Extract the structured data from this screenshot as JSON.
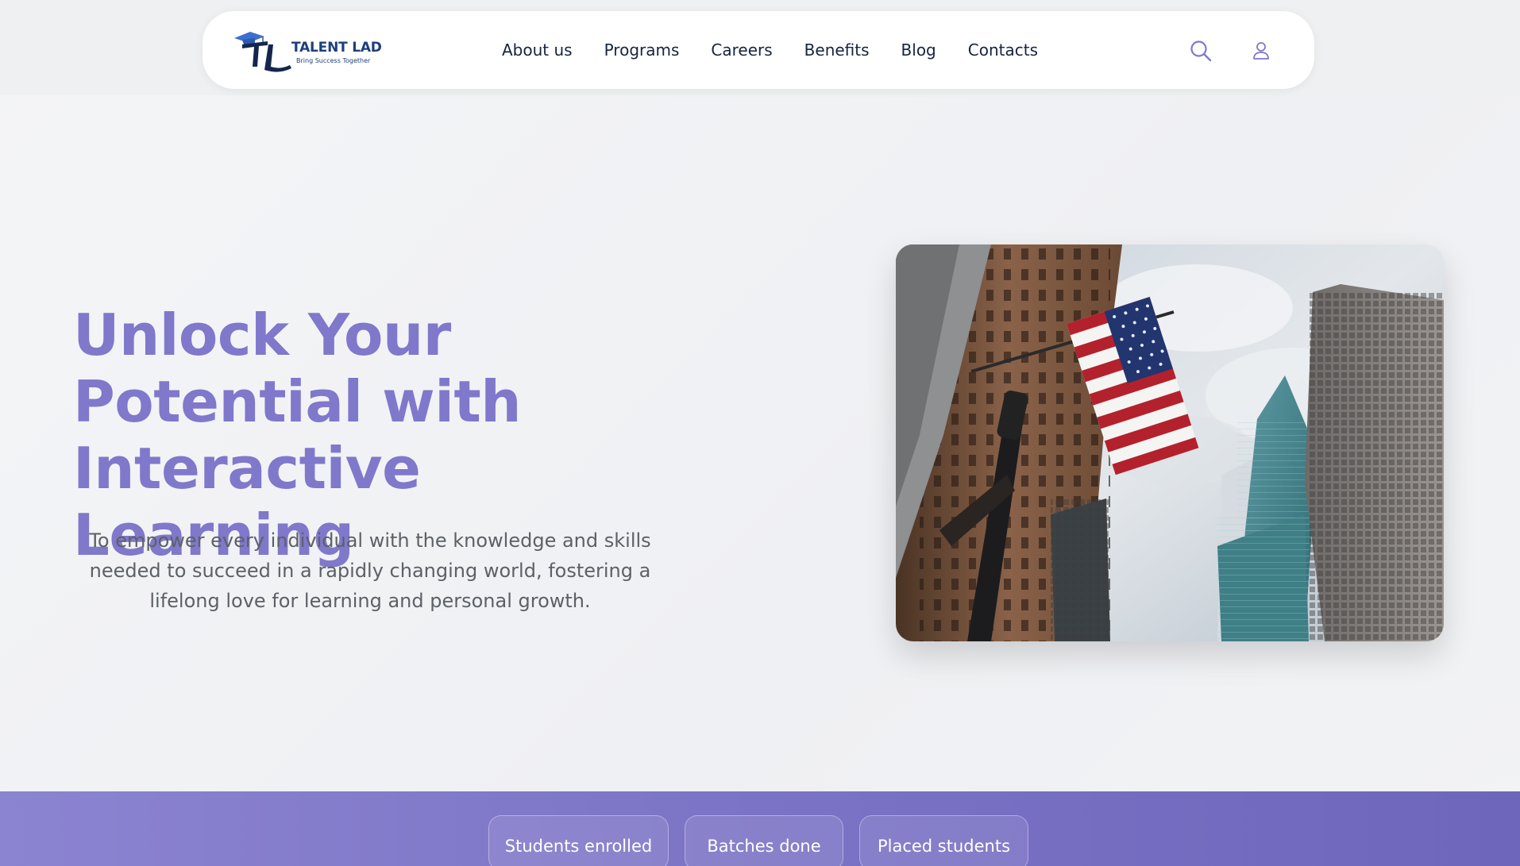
{
  "header": {
    "logo": {
      "initials": "TL",
      "name": "TALENT LAD",
      "tagline": "Bring Success Together"
    },
    "nav": [
      "About us",
      "Programs",
      "Careers",
      "Benefits",
      "Blog",
      "Contacts"
    ],
    "icons": {
      "search": "search-icon",
      "user": "user-icon"
    }
  },
  "hero": {
    "title_lines": [
      "Unlock Your",
      "Potential with",
      "Interactive Learning"
    ],
    "subtitle": "To empower every individual with the knowledge and skills needed to succeed in a rapidly changing world, fostering a lifelong love for learning and personal growth.",
    "image": "city-skyscrapers-american-flag-photo"
  },
  "stats": [
    "Students enrolled",
    "Batches done",
    "Placed students"
  ],
  "colors": {
    "accent": "#7f78cb",
    "nav_text": "#16243f",
    "logo": "#1d3f7c",
    "band_start": "#8b84d1",
    "band_end": "#6e66bb"
  }
}
